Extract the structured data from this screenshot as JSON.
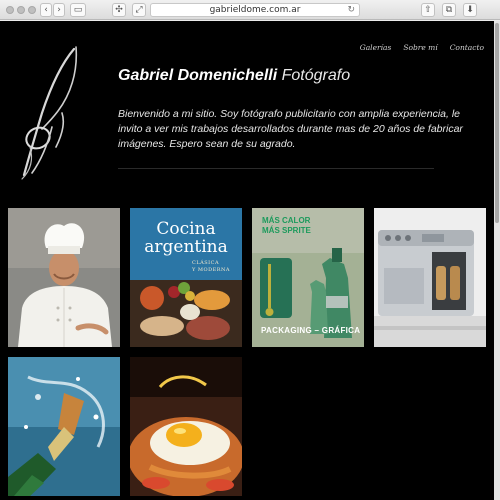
{
  "browser": {
    "url": "gabrieldome.com.ar"
  },
  "nav": {
    "items": [
      "Galerías",
      "Sobre mí",
      "Contacto"
    ]
  },
  "header": {
    "name": "Gabriel Domenichelli",
    "role": "Fotógrafo"
  },
  "intro": "Bienvenido a mi sitio. Soy fotógrafo publicitario con amplia experiencia, le invito a ver mis trabajos desarrollados durante mas de 20 años de fabricar imágenes. Espero sean de su agrado.",
  "gallery": {
    "book_title_line1": "Cocina",
    "book_title_line2": "argentina",
    "book_subtitle_line1": "CLÁSICA",
    "book_subtitle_line2": "Y MODERNA",
    "ad_line1": "MÁS CALOR",
    "ad_line2": "MÁS SPRITE",
    "packaging_label": "PACKAGING – GRÁFICA"
  },
  "colors": {
    "page_bg": "#000000",
    "text": "#ffffff",
    "nav_text": "#cfcfcf"
  }
}
